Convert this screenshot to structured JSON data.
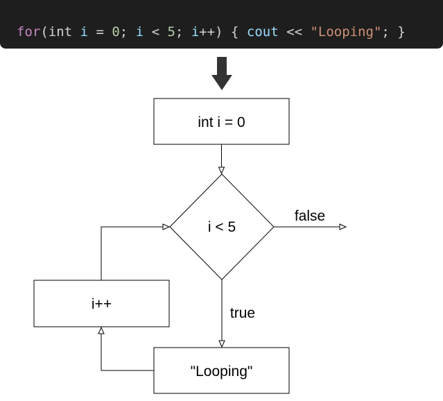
{
  "code": {
    "tokens": [
      {
        "text": "for",
        "kind": "keyword"
      },
      {
        "text": "(",
        "kind": "punct"
      },
      {
        "text": "int",
        "kind": "type"
      },
      {
        "text": " ",
        "kind": "punct"
      },
      {
        "text": "i",
        "kind": "var"
      },
      {
        "text": " = ",
        "kind": "op"
      },
      {
        "text": "0",
        "kind": "num"
      },
      {
        "text": "; ",
        "kind": "punct"
      },
      {
        "text": "i",
        "kind": "var"
      },
      {
        "text": " < ",
        "kind": "op"
      },
      {
        "text": "5",
        "kind": "num"
      },
      {
        "text": "; ",
        "kind": "punct"
      },
      {
        "text": "i",
        "kind": "var"
      },
      {
        "text": "++",
        "kind": "op"
      },
      {
        "text": ") { ",
        "kind": "punct"
      },
      {
        "text": "cout",
        "kind": "var"
      },
      {
        "text": " << ",
        "kind": "op"
      },
      {
        "text": "\"Looping\"",
        "kind": "str"
      },
      {
        "text": "; }",
        "kind": "punct"
      }
    ]
  },
  "flowchart": {
    "nodes": {
      "init": "int i = 0",
      "condition": "i < 5",
      "body": "\"Looping\"",
      "increment": "i++"
    },
    "edges": {
      "false_label": "false",
      "true_label": "true"
    }
  },
  "colors": {
    "code_background": "#1e1e1e",
    "stroke": "#000000",
    "big_arrow": "#333333"
  },
  "icons": {
    "pointer": "down-arrow-icon"
  }
}
